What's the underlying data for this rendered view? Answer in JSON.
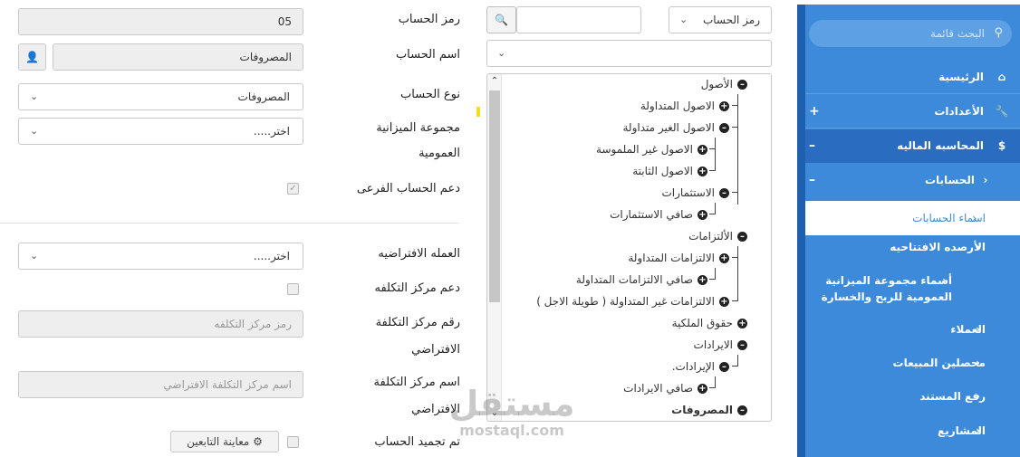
{
  "sidebar": {
    "search_placeholder": "البحث قائمة",
    "items": [
      {
        "label": "الرئيسية"
      },
      {
        "label": "الأعدادات"
      },
      {
        "label": "المحاسبه الماليه"
      },
      {
        "label": "الحسابات"
      }
    ],
    "active_sub": "اسماء الحسابات",
    "sub_items": [
      {
        "label": "الأرصده الافتتاحيه"
      },
      {
        "label": "أسماء مجموعة الميزانية العمومية للربح والخسارة"
      },
      {
        "label": "العملاء"
      },
      {
        "label": "محصلين المبيعات"
      },
      {
        "label": "رفع المستند"
      },
      {
        "label": "المشاريع"
      }
    ]
  },
  "middle": {
    "search_by": "رمز الحساب",
    "search_value": "",
    "second_select": "",
    "tree": [
      {
        "label": "الأصول",
        "icon": "minus"
      },
      {
        "label": "الاصول المتداولة",
        "icon": "plus"
      },
      {
        "label": "الاصول الغير متداولة",
        "icon": "minus"
      },
      {
        "label": "الاصول غير الملموسة",
        "icon": "plus"
      },
      {
        "label": "الاصول الثابتة",
        "icon": "plus"
      },
      {
        "label": "الاستثمارات",
        "icon": "minus"
      },
      {
        "label": "صافي الاستثمارات",
        "icon": "plus"
      },
      {
        "label": "الألتزامات",
        "icon": "minus"
      },
      {
        "label": "الالتزامات المتداولة",
        "icon": "plus"
      },
      {
        "label": "صافي الالتزامات المتداولة",
        "icon": "plus"
      },
      {
        "label": "الالتزامات غير المتداولة ( طويلة الاجل )",
        "icon": "plus"
      },
      {
        "label": "حقوق الملكية",
        "icon": "plus"
      },
      {
        "label": "الايرادات",
        "icon": "minus"
      },
      {
        "label": "الإيرادات.",
        "icon": "minus"
      },
      {
        "label": "صافي الايرادات",
        "icon": "plus"
      },
      {
        "label": "المصروفات",
        "icon": "minus"
      }
    ]
  },
  "form": {
    "account_code_label": "رمز الحساب",
    "account_code_value": "05",
    "account_name_label": "اسم الحساب",
    "account_name_value": "المصروفات",
    "account_type_label": "نوع الحساب",
    "account_type_value": "المصروفات",
    "budget_group_label": "مجموعة الميزانية العمومية",
    "budget_group_value": "اختر.....",
    "sub_account_label": "دعم الحساب الفرعى",
    "currency_label": "العمله الافتراضيه",
    "currency_value": "اختر.....",
    "cost_center_support_label": "دعم مركز التكلفه",
    "cost_center_code_label": "رقم مركز التكلفة الافتراضي",
    "cost_center_code_placeholder": "رمز مركز التكلفه",
    "cost_center_name_label": "اسم مركز التكلفة الافتراضي",
    "cost_center_name_placeholder": "اسم مركز التكلفة الافتراضي",
    "freeze_label": "تم تجميد الحساب",
    "preview_button": "معاينة التابعين"
  },
  "watermark": {
    "arabic": "مستقل",
    "latin": "mostaql.com"
  }
}
